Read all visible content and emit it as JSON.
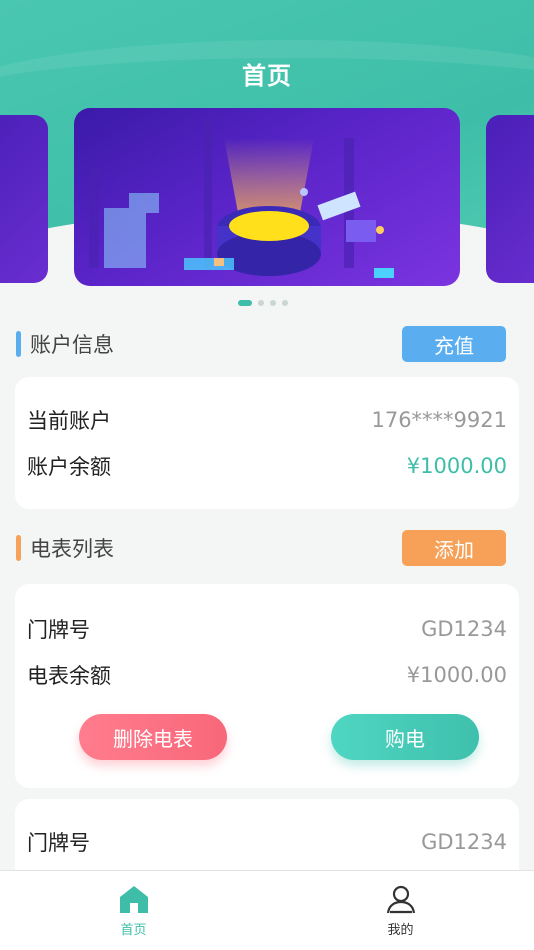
{
  "header": {
    "title": "首页"
  },
  "carousel": {
    "slides": 4,
    "active_index": 0
  },
  "account": {
    "section_title": "账户信息",
    "recharge_label": "充值",
    "current_account_label": "当前账户",
    "current_account_value": "176****9921",
    "balance_label": "账户余额",
    "balance_value": "¥1000.00"
  },
  "meters": {
    "section_title": "电表列表",
    "add_label": "添加",
    "items": [
      {
        "door_label": "门牌号",
        "door_value": "GD1234",
        "balance_label": "电表余额",
        "balance_value": "¥1000.00",
        "delete_label": "删除电表",
        "buy_label": "购电"
      },
      {
        "door_label": "门牌号",
        "door_value": "GD1234"
      }
    ]
  },
  "tabbar": {
    "tabs": [
      {
        "label": "首页",
        "icon": "home-icon",
        "active": true
      },
      {
        "label": "我的",
        "icon": "user-icon",
        "active": false
      }
    ]
  },
  "colors": {
    "brand_teal": "#3ebea8",
    "blue": "#5aaef0",
    "orange": "#f7a058",
    "red": "#f8677a"
  }
}
